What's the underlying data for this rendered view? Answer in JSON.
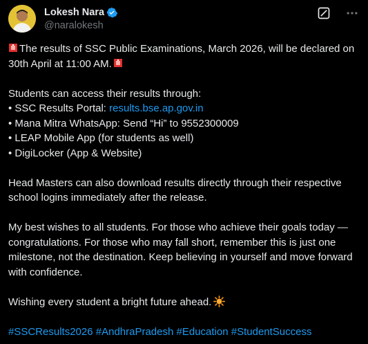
{
  "author": {
    "display_name": "Lokesh Nara",
    "handle": "@naralokesh",
    "verified": true,
    "avatar_icon": "avatar-photo",
    "verified_color": "#1d9bf0"
  },
  "header_icons": [
    "grok-icon",
    "more-icon"
  ],
  "tweet": {
    "line1": "The results of SSC Public Examinations, March 2026, will be declared on 30th April at 11:00 AM.",
    "access_intro": "Students can access their results through:",
    "bullet1_prefix": "• SSC Results Portal: ",
    "bullet1_link": "results.bse.ap.gov.in",
    "bullet2": "• Mana Mitra WhatsApp: Send “Hi” to 9552300009",
    "bullet3": "• LEAP Mobile App (for students as well)",
    "bullet4": "• DigiLocker (App & Website)",
    "headmasters": "Head Masters can also download results directly through their respective school logins immediately after the release.",
    "wishes": "My best wishes to all students. For those who achieve their goals today —congratulations. For those who may fall short, remember this is just one milestone, not the destination. Keep believing in yourself and move forward with confidence.",
    "closing": "Wishing every student a bright future ahead.",
    "hashtags": [
      "#SSCResults2026",
      "#AndhraPradesh",
      "#Education",
      "#StudentSuccess"
    ]
  },
  "colors": {
    "background": "#000000",
    "text": "#e7e9ea",
    "secondary": "#71767b",
    "link": "#1d9bf0"
  }
}
